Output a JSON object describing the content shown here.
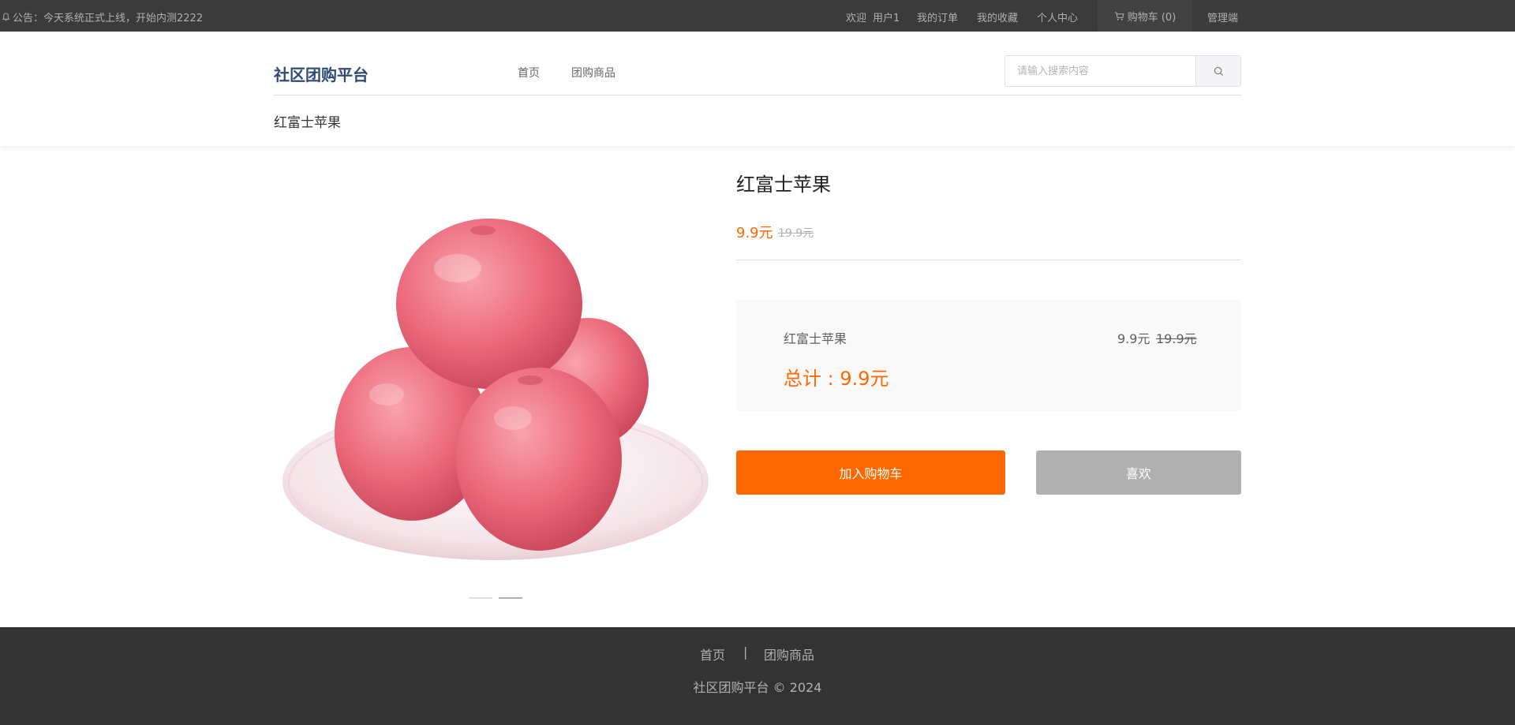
{
  "topbar": {
    "notice": "公告：今天系统正式上线，开始内测2222",
    "welcome": "欢迎",
    "username": "用户1",
    "links": [
      "我的订单",
      "我的收藏",
      "个人中心"
    ],
    "cart_label": "购物车 (0)",
    "admin": "管理端"
  },
  "header": {
    "logo": "社区团购平台",
    "nav": [
      "首页",
      "团购商品"
    ],
    "search_placeholder": "请输入搜索内容",
    "breadcrumb": "红富士苹果"
  },
  "product": {
    "title": "红富士苹果",
    "price": "9.9元",
    "original_price": "19.9元",
    "carousel": {
      "slides": 2,
      "active": 2
    }
  },
  "summary": {
    "name": "红富士苹果",
    "price": "9.9元",
    "original_price": "19.9元",
    "total": "总计 : 9.9元"
  },
  "actions": {
    "add_to_cart": "加入购物车",
    "like": "喜欢"
  },
  "footer": {
    "links": [
      "首页",
      "团购商品"
    ],
    "separator": "|",
    "copyright": "社区团购平台 © 2024"
  },
  "colors": {
    "accent": "#ff6700",
    "logo": "#2f4a73",
    "topbar_bg": "#3b3b3b",
    "footer_bg": "#333333",
    "disabled_button": "#b0b0b0"
  }
}
